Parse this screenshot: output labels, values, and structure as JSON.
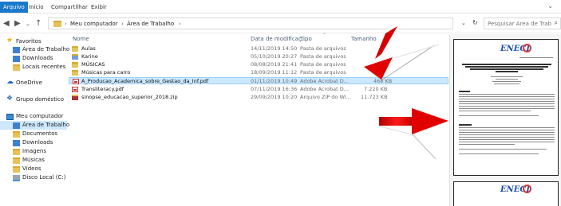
{
  "ribbon": {
    "tabs": [
      "Arquivo",
      "Início",
      "Compartilhar",
      "Exibir"
    ]
  },
  "address": {
    "crumbs": [
      "Meu computador",
      "Área de Trabalho"
    ]
  },
  "search": {
    "placeholder": "Pesquisar Área de Trabalho"
  },
  "nav": {
    "items": [
      {
        "label": "Favoritos",
        "icon": "star-icon"
      },
      {
        "label": "Área de Trabalho",
        "icon": "desktop-icon"
      },
      {
        "label": "Downloads",
        "icon": "downloads-icon"
      },
      {
        "label": "Locais recentes",
        "icon": "recent-places-icon"
      },
      {
        "label": "OneDrive",
        "icon": "onedrive-icon"
      },
      {
        "label": "Grupo doméstico",
        "icon": "homegroup-icon"
      },
      {
        "label": "Meu computador",
        "icon": "computer-icon"
      },
      {
        "label": "Área de Trabalho",
        "icon": "desktop-icon"
      },
      {
        "label": "Documentos",
        "icon": "documents-icon"
      },
      {
        "label": "Downloads",
        "icon": "downloads-icon"
      },
      {
        "label": "Imagens",
        "icon": "pictures-icon"
      },
      {
        "label": "Músicas",
        "icon": "music-icon"
      },
      {
        "label": "Vídeos",
        "icon": "videos-icon"
      },
      {
        "label": "Disco Local (C:)",
        "icon": "local-disk-icon"
      }
    ]
  },
  "columns": {
    "name": "Nome",
    "date": "Data de modificaç...",
    "type": "Tipo",
    "size": "Tamanho"
  },
  "files": [
    {
      "name": "Aulas",
      "date": "14/11/2019 14:50",
      "type": "Pasta de arquivos",
      "size": "",
      "icon": "folder-icon"
    },
    {
      "name": "Karine",
      "date": "05/10/2019 20:27",
      "type": "Pasta de arquivos",
      "size": "",
      "icon": "folder-icon"
    },
    {
      "name": "MÚSICAS",
      "date": "08/08/2019 21:41",
      "type": "Pasta de arquivos",
      "size": "",
      "icon": "folder-icon"
    },
    {
      "name": "Músicas para carro",
      "date": "18/09/2019 11:12",
      "type": "Pasta de arquivos",
      "size": "",
      "icon": "folder-icon"
    },
    {
      "name": "A_Producao_Academica_sobre_Gestao_da_Inf.pdf",
      "date": "01/11/2019 10:49",
      "type": "Adobe Acrobat D...",
      "size": "468 KB",
      "icon": "pdf-icon"
    },
    {
      "name": "Transliteracy.pdf",
      "date": "07/11/2019 16:36",
      "type": "Adobe Acrobat D...",
      "size": "7.220 KB",
      "icon": "pdf-icon"
    },
    {
      "name": "sinopse_educacao_superior_2018.zip",
      "date": "29/09/2019 10:20",
      "type": "Arquivo ZIP do Wi...",
      "size": "11.723 KB",
      "icon": "zip-icon"
    }
  ],
  "preview": {
    "logo_text": "ENECI"
  }
}
